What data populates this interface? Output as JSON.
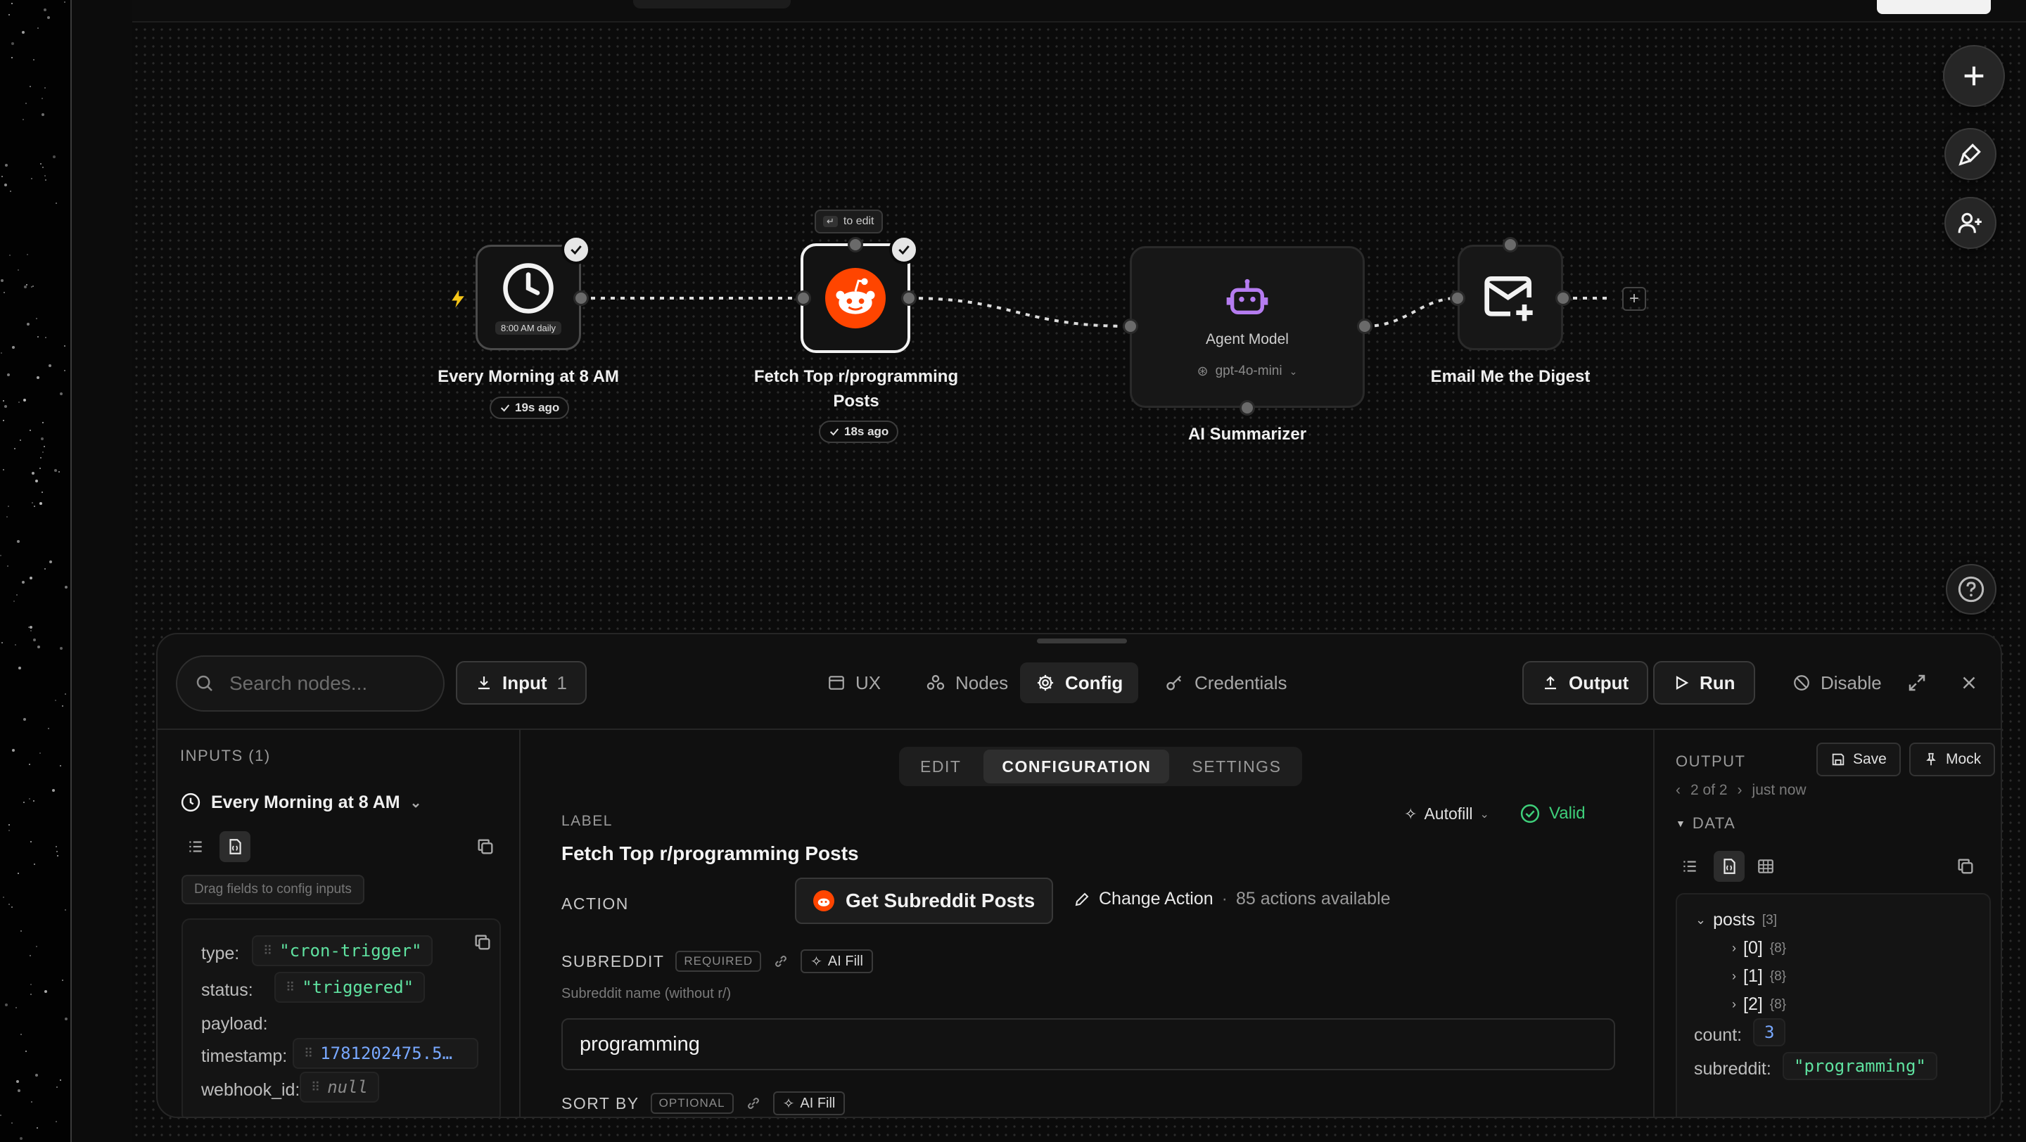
{
  "canvas": {
    "nodes": {
      "trigger": {
        "title": "Every Morning at 8 AM",
        "sublabel": "8:00 AM daily",
        "badge": "19s ago"
      },
      "reddit": {
        "title": "Fetch Top r/programming Posts",
        "hint": "to edit",
        "badge": "18s ago"
      },
      "agent": {
        "title": "AI Summarizer",
        "type_label": "Agent Model",
        "model": "gpt-4o-mini"
      },
      "email": {
        "title": "Email Me the Digest"
      }
    },
    "floating_buttons": [
      "plus-icon",
      "brush-icon",
      "user-plus-icon"
    ],
    "help_icon": "help-icon"
  },
  "panel": {
    "search_placeholder": "Search nodes...",
    "input_button": {
      "label": "Input",
      "count": "1"
    },
    "tabs": [
      {
        "label": "UX",
        "icon": "window-icon",
        "active": false
      },
      {
        "label": "Nodes",
        "icon": "nodes-icon",
        "active": false
      },
      {
        "label": "Config",
        "icon": "gear-icon",
        "active": true
      },
      {
        "label": "Credentials",
        "icon": "key-icon",
        "active": false
      }
    ],
    "actions": {
      "output": "Output",
      "run": "Run",
      "disable": "Disable"
    },
    "inputs": {
      "header": "INPUTS (1)",
      "source": "Every Morning at 8 AM",
      "hint": "Drag fields to config inputs",
      "fields": [
        {
          "key": "type:",
          "value": "\"cron-trigger\"",
          "kind": "string"
        },
        {
          "key": "status:",
          "value": "\"triggered\"",
          "kind": "string"
        },
        {
          "key": "payload:",
          "value": "",
          "kind": "none"
        },
        {
          "key": "timestamp:",
          "value": "1781202475.5…",
          "kind": "number"
        },
        {
          "key": "webhook_id:",
          "value": "null",
          "kind": "null"
        }
      ]
    },
    "config": {
      "segments": [
        "EDIT",
        "CONFIGURATION",
        "SETTINGS"
      ],
      "active_segment": "CONFIGURATION",
      "label_caption": "LABEL",
      "label_value": "Fetch Top r/programming Posts",
      "autofill": "Autofill",
      "valid": "Valid",
      "action_caption": "ACTION",
      "action_value": "Get Subreddit Posts",
      "change_action": "Change Action",
      "actions_available": "85 actions available",
      "subreddit_caption": "SUBREDDIT",
      "required_tag": "REQUIRED",
      "ai_fill": "AI Fill",
      "subreddit_hint": "Subreddit name (without r/)",
      "subreddit_value": "programming",
      "sort_caption": "SORT BY",
      "optional_tag": "OPTIONAL"
    },
    "output": {
      "header": "OUTPUT",
      "save": "Save",
      "mock": "Mock",
      "pager": "2 of 2",
      "time": "just now",
      "data_header": "DATA",
      "posts_key": "posts",
      "posts_count": "[3]",
      "items": [
        {
          "key": "[0]",
          "count": "{8}"
        },
        {
          "key": "[1]",
          "count": "{8}"
        },
        {
          "key": "[2]",
          "count": "{8}"
        }
      ],
      "count_key": "count:",
      "count_value": "3",
      "subreddit_key": "subreddit:",
      "subreddit_value": "\"programming\""
    }
  },
  "colors": {
    "accent_reddit": "#ff4500",
    "valid_green": "#3ecf7a",
    "agent_purple": "#b57cf0",
    "string_green": "#5fe2a0",
    "number_blue": "#78a8ff"
  }
}
